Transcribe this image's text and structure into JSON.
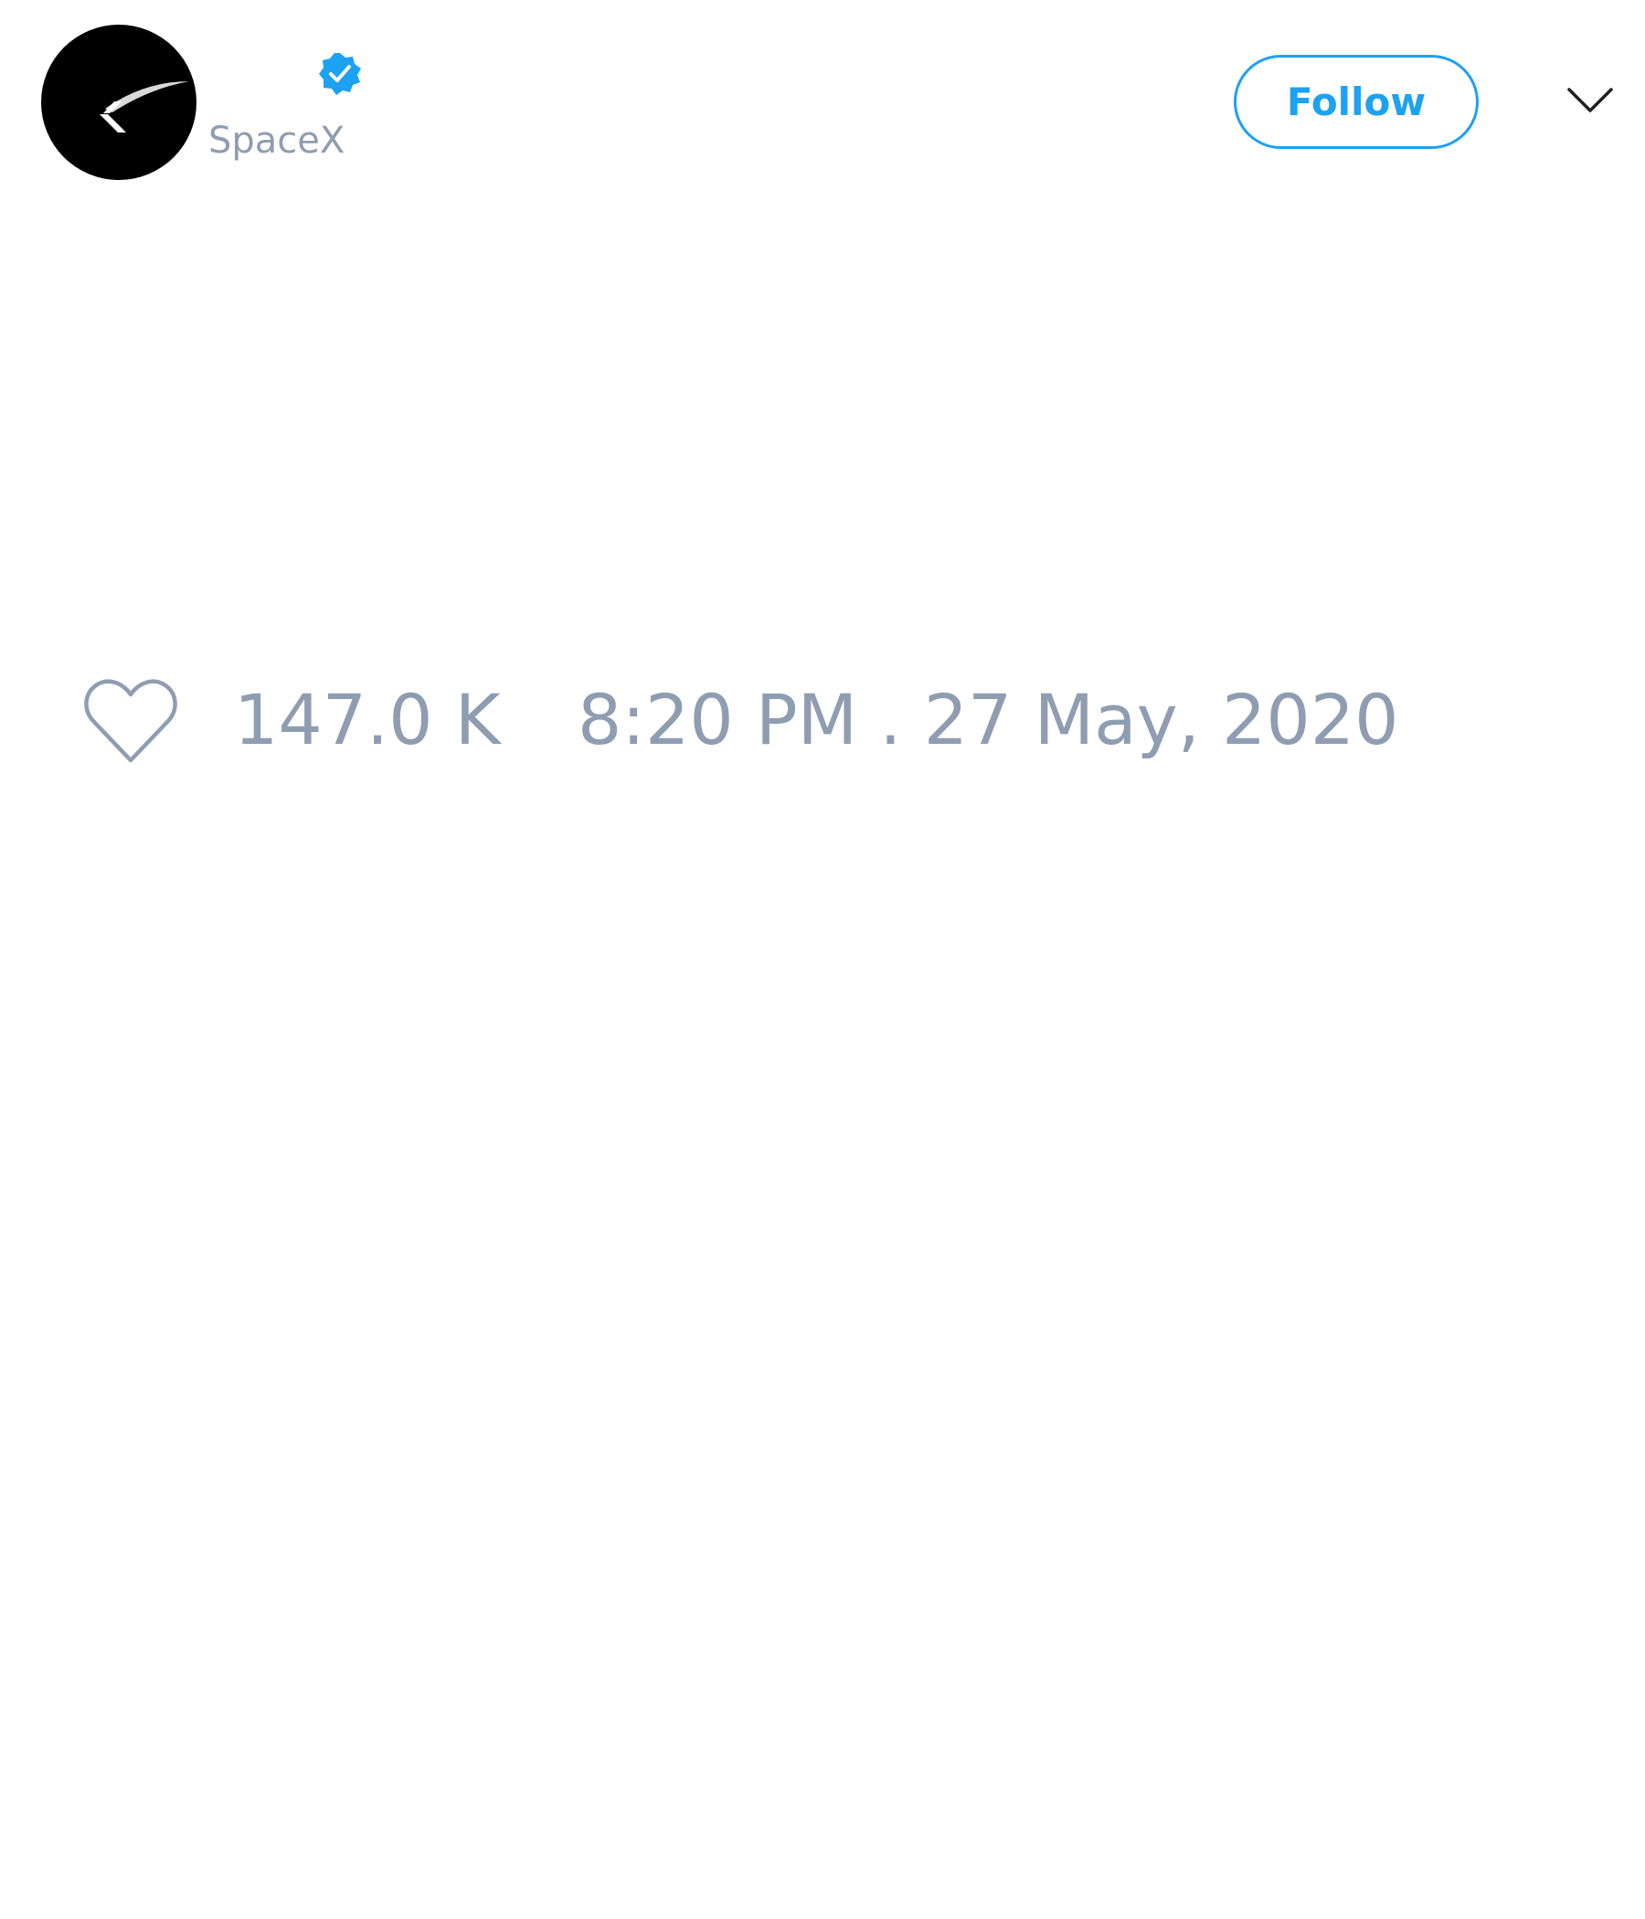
{
  "tweet": {
    "account": {
      "handle": "SpaceX",
      "avatar_icon": "spacex-logo-icon",
      "verified_icon": "verified-badge-icon"
    },
    "follow_button": {
      "label": "Follow"
    },
    "menu_icon": "chevron-down-icon",
    "stats": {
      "like_icon": "heart-icon",
      "like_count": "147.0 K",
      "timestamp": "8:20 PM . 27 May, 2020"
    }
  },
  "colors": {
    "accent": "#1da1f2",
    "muted_text": "#8f9db1",
    "avatar_background": "#000000"
  }
}
